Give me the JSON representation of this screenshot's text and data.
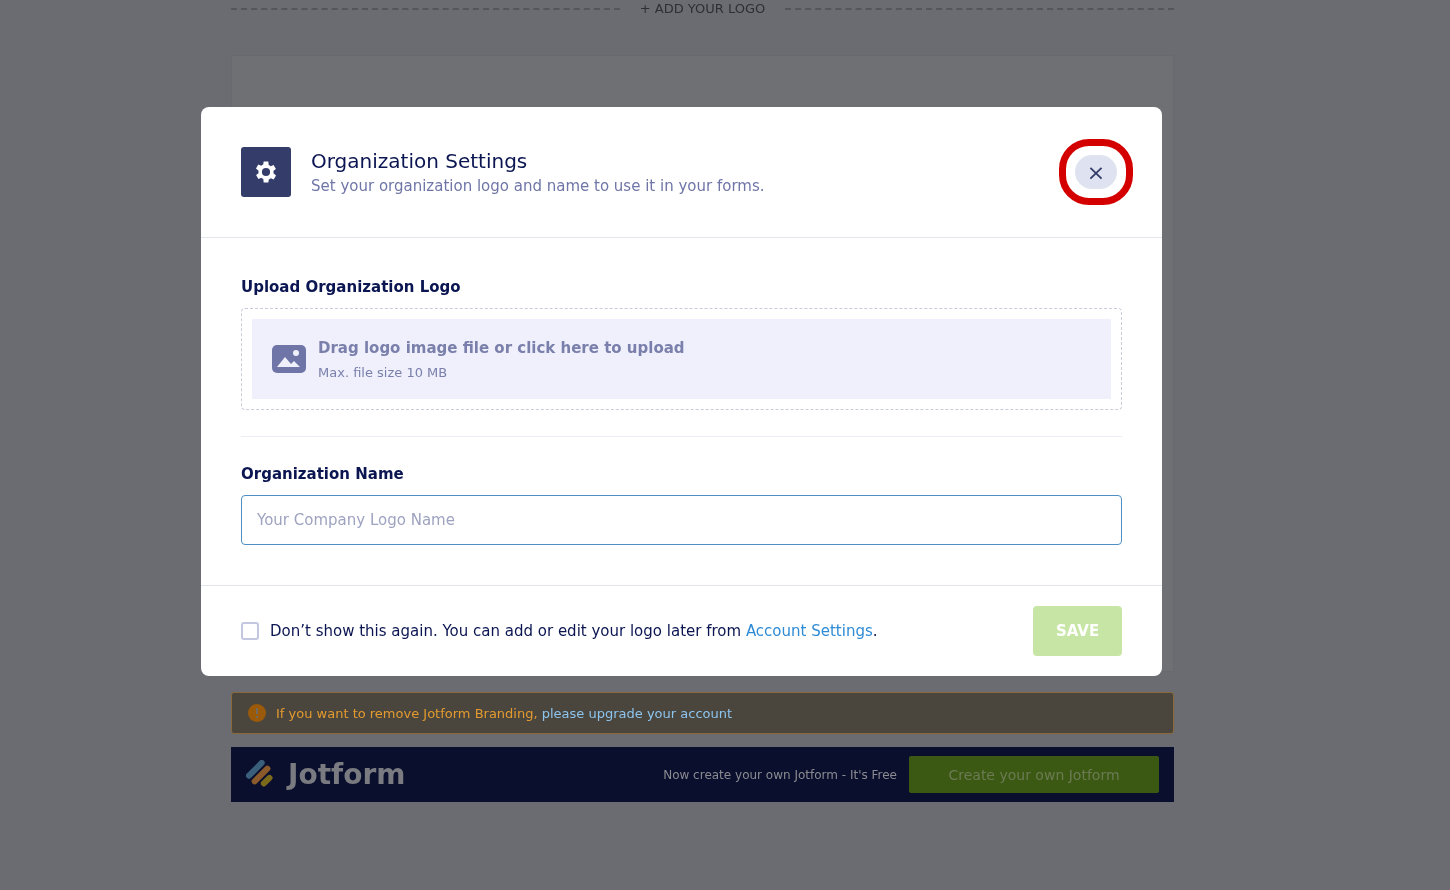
{
  "background": {
    "logo_prompt": "+ ADD YOUR LOGO",
    "notice": {
      "text": "If you want to remove Jotform Branding,",
      "link": "please upgrade your account"
    },
    "banner": {
      "brand": "Jotform",
      "tagline": "Now create your own Jotform - It's Free",
      "button": "Create your own Jotform"
    }
  },
  "dialog": {
    "title": "Organization Settings",
    "subtitle": "Set your organization logo and name to use it in your forms.",
    "close": "×",
    "close_highlighted": true,
    "upload": {
      "label": "Upload Organization Logo",
      "prompt": "Drag logo image file or click here to upload",
      "hint": "Max. file size 10 MB"
    },
    "name_field": {
      "label": "Organization Name",
      "placeholder": "Your Company Logo Name"
    },
    "footer": {
      "checked": false,
      "text": "Don’t show this again. You can add or edit your logo later from",
      "link": "Account Settings",
      "after": ".",
      "save": "SAVE",
      "save_disabled": true
    }
  }
}
